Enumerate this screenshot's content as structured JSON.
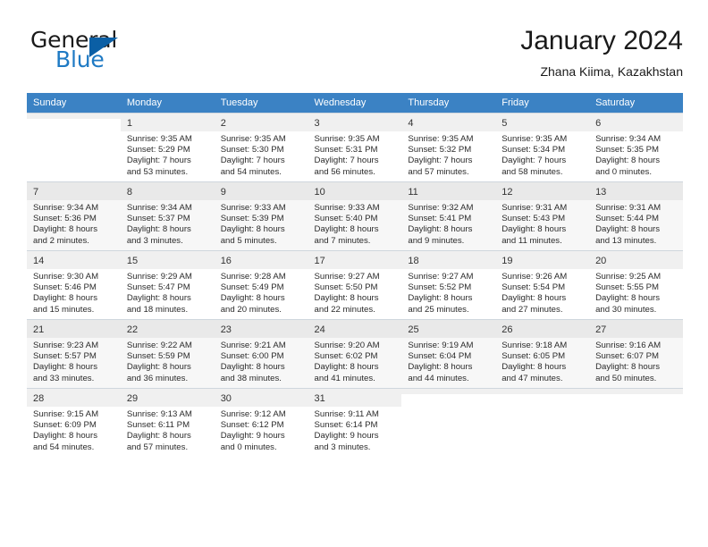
{
  "brand": {
    "word_one": "General",
    "word_two": "Blue",
    "logo_icon": "blue-triangle-logo",
    "accent_color": "#1f7ac4",
    "triangle_color": "#0b5fa5"
  },
  "header": {
    "title": "January 2024",
    "subtitle": "Zhana Kiima, Kazakhstan"
  },
  "calendar": {
    "header_background": "#3b82c4",
    "weekday_headers": [
      "Sunday",
      "Monday",
      "Tuesday",
      "Wednesday",
      "Thursday",
      "Friday",
      "Saturday"
    ],
    "weeks": [
      {
        "band": "band-white",
        "days": [
          {
            "num": "",
            "sunrise": "",
            "sunset": "",
            "daylight_line1": "",
            "daylight_line2": ""
          },
          {
            "num": "1",
            "sunrise": "Sunrise: 9:35 AM",
            "sunset": "Sunset: 5:29 PM",
            "daylight_line1": "Daylight: 7 hours",
            "daylight_line2": "and 53 minutes."
          },
          {
            "num": "2",
            "sunrise": "Sunrise: 9:35 AM",
            "sunset": "Sunset: 5:30 PM",
            "daylight_line1": "Daylight: 7 hours",
            "daylight_line2": "and 54 minutes."
          },
          {
            "num": "3",
            "sunrise": "Sunrise: 9:35 AM",
            "sunset": "Sunset: 5:31 PM",
            "daylight_line1": "Daylight: 7 hours",
            "daylight_line2": "and 56 minutes."
          },
          {
            "num": "4",
            "sunrise": "Sunrise: 9:35 AM",
            "sunset": "Sunset: 5:32 PM",
            "daylight_line1": "Daylight: 7 hours",
            "daylight_line2": "and 57 minutes."
          },
          {
            "num": "5",
            "sunrise": "Sunrise: 9:35 AM",
            "sunset": "Sunset: 5:34 PM",
            "daylight_line1": "Daylight: 7 hours",
            "daylight_line2": "and 58 minutes."
          },
          {
            "num": "6",
            "sunrise": "Sunrise: 9:34 AM",
            "sunset": "Sunset: 5:35 PM",
            "daylight_line1": "Daylight: 8 hours",
            "daylight_line2": "and 0 minutes."
          }
        ]
      },
      {
        "band": "band-gray",
        "days": [
          {
            "num": "7",
            "sunrise": "Sunrise: 9:34 AM",
            "sunset": "Sunset: 5:36 PM",
            "daylight_line1": "Daylight: 8 hours",
            "daylight_line2": "and 2 minutes."
          },
          {
            "num": "8",
            "sunrise": "Sunrise: 9:34 AM",
            "sunset": "Sunset: 5:37 PM",
            "daylight_line1": "Daylight: 8 hours",
            "daylight_line2": "and 3 minutes."
          },
          {
            "num": "9",
            "sunrise": "Sunrise: 9:33 AM",
            "sunset": "Sunset: 5:39 PM",
            "daylight_line1": "Daylight: 8 hours",
            "daylight_line2": "and 5 minutes."
          },
          {
            "num": "10",
            "sunrise": "Sunrise: 9:33 AM",
            "sunset": "Sunset: 5:40 PM",
            "daylight_line1": "Daylight: 8 hours",
            "daylight_line2": "and 7 minutes."
          },
          {
            "num": "11",
            "sunrise": "Sunrise: 9:32 AM",
            "sunset": "Sunset: 5:41 PM",
            "daylight_line1": "Daylight: 8 hours",
            "daylight_line2": "and 9 minutes."
          },
          {
            "num": "12",
            "sunrise": "Sunrise: 9:31 AM",
            "sunset": "Sunset: 5:43 PM",
            "daylight_line1": "Daylight: 8 hours",
            "daylight_line2": "and 11 minutes."
          },
          {
            "num": "13",
            "sunrise": "Sunrise: 9:31 AM",
            "sunset": "Sunset: 5:44 PM",
            "daylight_line1": "Daylight: 8 hours",
            "daylight_line2": "and 13 minutes."
          }
        ]
      },
      {
        "band": "band-white",
        "days": [
          {
            "num": "14",
            "sunrise": "Sunrise: 9:30 AM",
            "sunset": "Sunset: 5:46 PM",
            "daylight_line1": "Daylight: 8 hours",
            "daylight_line2": "and 15 minutes."
          },
          {
            "num": "15",
            "sunrise": "Sunrise: 9:29 AM",
            "sunset": "Sunset: 5:47 PM",
            "daylight_line1": "Daylight: 8 hours",
            "daylight_line2": "and 18 minutes."
          },
          {
            "num": "16",
            "sunrise": "Sunrise: 9:28 AM",
            "sunset": "Sunset: 5:49 PM",
            "daylight_line1": "Daylight: 8 hours",
            "daylight_line2": "and 20 minutes."
          },
          {
            "num": "17",
            "sunrise": "Sunrise: 9:27 AM",
            "sunset": "Sunset: 5:50 PM",
            "daylight_line1": "Daylight: 8 hours",
            "daylight_line2": "and 22 minutes."
          },
          {
            "num": "18",
            "sunrise": "Sunrise: 9:27 AM",
            "sunset": "Sunset: 5:52 PM",
            "daylight_line1": "Daylight: 8 hours",
            "daylight_line2": "and 25 minutes."
          },
          {
            "num": "19",
            "sunrise": "Sunrise: 9:26 AM",
            "sunset": "Sunset: 5:54 PM",
            "daylight_line1": "Daylight: 8 hours",
            "daylight_line2": "and 27 minutes."
          },
          {
            "num": "20",
            "sunrise": "Sunrise: 9:25 AM",
            "sunset": "Sunset: 5:55 PM",
            "daylight_line1": "Daylight: 8 hours",
            "daylight_line2": "and 30 minutes."
          }
        ]
      },
      {
        "band": "band-gray",
        "days": [
          {
            "num": "21",
            "sunrise": "Sunrise: 9:23 AM",
            "sunset": "Sunset: 5:57 PM",
            "daylight_line1": "Daylight: 8 hours",
            "daylight_line2": "and 33 minutes."
          },
          {
            "num": "22",
            "sunrise": "Sunrise: 9:22 AM",
            "sunset": "Sunset: 5:59 PM",
            "daylight_line1": "Daylight: 8 hours",
            "daylight_line2": "and 36 minutes."
          },
          {
            "num": "23",
            "sunrise": "Sunrise: 9:21 AM",
            "sunset": "Sunset: 6:00 PM",
            "daylight_line1": "Daylight: 8 hours",
            "daylight_line2": "and 38 minutes."
          },
          {
            "num": "24",
            "sunrise": "Sunrise: 9:20 AM",
            "sunset": "Sunset: 6:02 PM",
            "daylight_line1": "Daylight: 8 hours",
            "daylight_line2": "and 41 minutes."
          },
          {
            "num": "25",
            "sunrise": "Sunrise: 9:19 AM",
            "sunset": "Sunset: 6:04 PM",
            "daylight_line1": "Daylight: 8 hours",
            "daylight_line2": "and 44 minutes."
          },
          {
            "num": "26",
            "sunrise": "Sunrise: 9:18 AM",
            "sunset": "Sunset: 6:05 PM",
            "daylight_line1": "Daylight: 8 hours",
            "daylight_line2": "and 47 minutes."
          },
          {
            "num": "27",
            "sunrise": "Sunrise: 9:16 AM",
            "sunset": "Sunset: 6:07 PM",
            "daylight_line1": "Daylight: 8 hours",
            "daylight_line2": "and 50 minutes."
          }
        ]
      },
      {
        "band": "band-white",
        "days": [
          {
            "num": "28",
            "sunrise": "Sunrise: 9:15 AM",
            "sunset": "Sunset: 6:09 PM",
            "daylight_line1": "Daylight: 8 hours",
            "daylight_line2": "and 54 minutes."
          },
          {
            "num": "29",
            "sunrise": "Sunrise: 9:13 AM",
            "sunset": "Sunset: 6:11 PM",
            "daylight_line1": "Daylight: 8 hours",
            "daylight_line2": "and 57 minutes."
          },
          {
            "num": "30",
            "sunrise": "Sunrise: 9:12 AM",
            "sunset": "Sunset: 6:12 PM",
            "daylight_line1": "Daylight: 9 hours",
            "daylight_line2": "and 0 minutes."
          },
          {
            "num": "31",
            "sunrise": "Sunrise: 9:11 AM",
            "sunset": "Sunset: 6:14 PM",
            "daylight_line1": "Daylight: 9 hours",
            "daylight_line2": "and 3 minutes."
          },
          {
            "num": "",
            "sunrise": "",
            "sunset": "",
            "daylight_line1": "",
            "daylight_line2": ""
          },
          {
            "num": "",
            "sunrise": "",
            "sunset": "",
            "daylight_line1": "",
            "daylight_line2": ""
          },
          {
            "num": "",
            "sunrise": "",
            "sunset": "",
            "daylight_line1": "",
            "daylight_line2": ""
          }
        ]
      }
    ]
  }
}
